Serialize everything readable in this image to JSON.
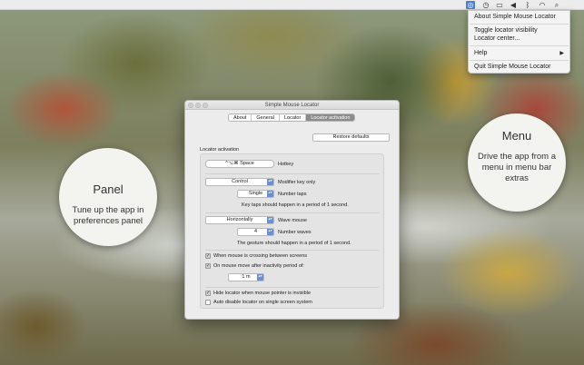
{
  "menubar": {
    "icons": [
      "locator-icon",
      "clock-icon",
      "display-icon",
      "volume-icon",
      "bluetooth-icon",
      "wifi-icon",
      "search-icon"
    ]
  },
  "menu": {
    "items": [
      "About Simple Mouse Locator",
      "Toggle locator visibility",
      "Locator center...",
      "Help",
      "Quit Simple Mouse Locator"
    ]
  },
  "callouts": {
    "panel": {
      "title": "Panel",
      "desc": "Tune up the app in preferences panel"
    },
    "menu": {
      "title": "Menu",
      "desc": "Drive the app from a menu in menu bar extras"
    }
  },
  "window": {
    "title": "Simple Mouse Locator",
    "tabs": [
      "About",
      "General",
      "Locator",
      "Locator activation"
    ],
    "selected_tab": "Locator activation",
    "restore_button": "Restore defaults",
    "section_title": "Locator activation",
    "hotkey_value": "^⌥⌘ Space",
    "hotkey_label": "Hotkey",
    "modifier_value": "Control",
    "modifier_label": "Modifier key only",
    "taps_value": "Single",
    "taps_label": "Number taps",
    "taps_note": "Key taps should happen in a period of 1 second.",
    "gesture_value": "Horizontally",
    "gesture_label": "Wave mouse",
    "waves_value": "4",
    "waves_label": "Number waves",
    "gesture_note": "The gesture should happen in a period of 1 second.",
    "cb1_label": "When mouse is crossing between screens",
    "cb2_label": "On mouse move after inactivity period of:",
    "inactivity_value": "1 m",
    "cb3_label": "Hide locator when mouse pointer is invisible",
    "cb4_label": "Auto disable locator on single screen system"
  }
}
